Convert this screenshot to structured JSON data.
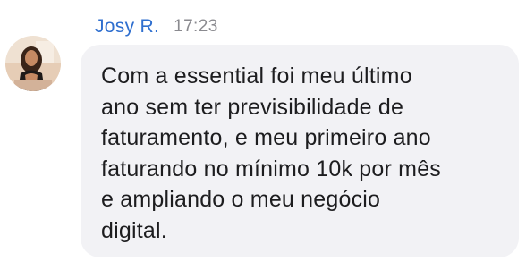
{
  "message": {
    "author": "Josy R.",
    "time": "17:23",
    "avatar_icon": "user-photo-avatar",
    "text": "Com a essential foi meu último\nano sem ter previsibilidade de\nfaturamento, e meu primeiro ano\nfaturando no mínimo 10k por mês\ne ampliando o meu negócio\ndigital."
  },
  "colors": {
    "author": "#2f6fcf",
    "time": "#8a8a8f",
    "bubble": "#f2f2f5",
    "text": "#1d1d1f"
  }
}
